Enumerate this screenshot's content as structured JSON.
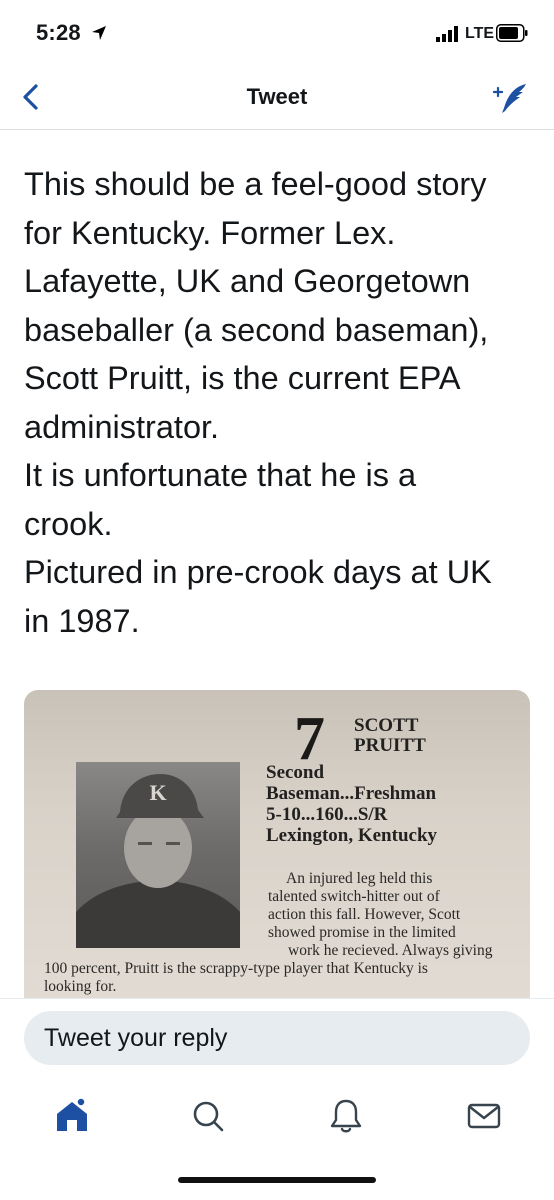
{
  "status_bar": {
    "time": "5:28",
    "network": "LTE"
  },
  "nav": {
    "title": "Tweet"
  },
  "tweet": {
    "lines": [
      "This should be a feel-good story",
      "for Kentucky. Former Lex.",
      "Lafayette, UK and Georgetown",
      "baseballer (a second baseman),",
      "Scott Pruitt, is the current EPA",
      "administrator.",
      "It is unfortunate that he is a",
      "crook.",
      "Pictured in pre-crook days at UK",
      "in 1987."
    ]
  },
  "media": {
    "number": "7",
    "name_lines": [
      "SCOTT",
      "PRUITT"
    ],
    "info_lines": [
      "Second",
      "Baseman...Freshman",
      "5-10...160...S/R",
      "Lexington, Kentucky"
    ],
    "bio_lines": [
      "An injured leg held this",
      "talented switch-hitter out of",
      "action this fall. However, Scott",
      "showed promise in the limited",
      "work he recieved. Always giving",
      "100 percent, Pruitt is the scrappy-type player that Kentucky is",
      "looking for."
    ],
    "cap_letter": "K"
  },
  "reply": {
    "placeholder": "Tweet your reply"
  },
  "tabs": [
    "home-icon",
    "search-icon",
    "notifications-icon",
    "messages-icon"
  ],
  "colors": {
    "accent": "#1d4fa3",
    "text": "#14171a",
    "reply_bg": "#e6ecf0"
  }
}
